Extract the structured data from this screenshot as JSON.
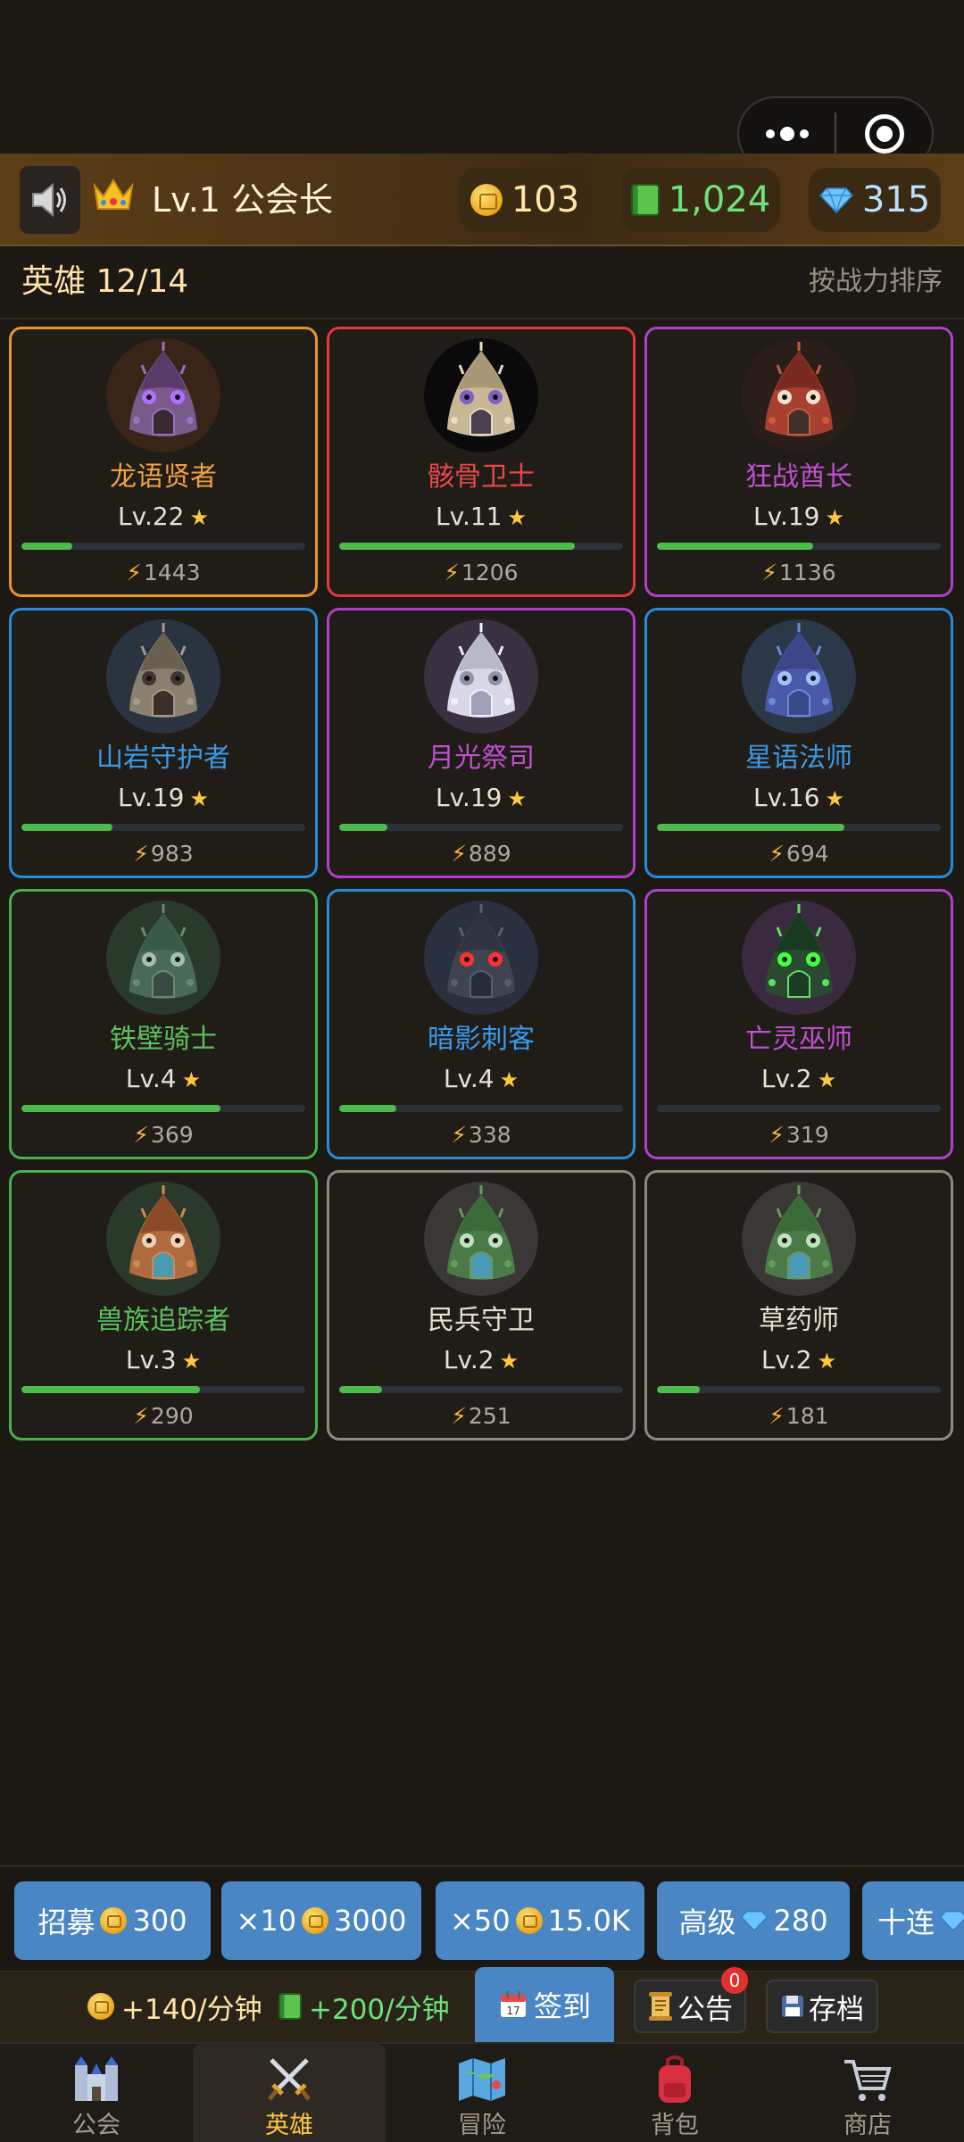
{
  "top_bar": {
    "rank_label": "Lv.1 公会长",
    "gold": "103",
    "books": "1,024",
    "gems": "315"
  },
  "heroes_header": {
    "title": "英雄 12/14",
    "sort_label": "按战力排序"
  },
  "colors": {
    "legendary": "#e8962a",
    "red": "#e03a3a",
    "epic": "#b040c8",
    "rare": "#2a8ad8",
    "uncommon": "#4cae4c",
    "common": "#8c8884",
    "xp_fill": "#4cbb4c"
  },
  "heroes": [
    {
      "name": "龙语贤者",
      "level": "Lv.22",
      "power": "1443",
      "xp": 0.18,
      "color": "#e8962a",
      "namecolor": "#f0a040",
      "avatar": "purple"
    },
    {
      "name": "骸骨卫士",
      "level": "Lv.11",
      "power": "1206",
      "xp": 0.83,
      "color": "#e03a3a",
      "namecolor": "#e84848",
      "avatar": "bone"
    },
    {
      "name": "狂战酋长",
      "level": "Lv.19",
      "power": "1136",
      "xp": 0.55,
      "color": "#b040c8",
      "namecolor": "#c050d0",
      "avatar": "red"
    },
    {
      "name": "山岩守护者",
      "level": "Lv.19",
      "power": "983",
      "xp": 0.32,
      "color": "#2a8ad8",
      "namecolor": "#3a9ae8",
      "avatar": "stone"
    },
    {
      "name": "月光祭司",
      "level": "Lv.19",
      "power": "889",
      "xp": 0.17,
      "color": "#b040c8",
      "namecolor": "#c050d0",
      "avatar": "white"
    },
    {
      "name": "星语法师",
      "level": "Lv.16",
      "power": "694",
      "xp": 0.66,
      "color": "#2a8ad8",
      "namecolor": "#3a9ae8",
      "avatar": "blue"
    },
    {
      "name": "铁壁骑士",
      "level": "Lv.4",
      "power": "369",
      "xp": 0.7,
      "color": "#4cae4c",
      "namecolor": "#5cc05c",
      "avatar": "mossy"
    },
    {
      "name": "暗影刺客",
      "level": "Lv.4",
      "power": "338",
      "xp": 0.2,
      "color": "#2a8ad8",
      "namecolor": "#3a9ae8",
      "avatar": "dark"
    },
    {
      "name": "亡灵巫师",
      "level": "Lv.2",
      "power": "319",
      "xp": 0.0,
      "color": "#b040c8",
      "namecolor": "#c050d0",
      "avatar": "ghoul"
    },
    {
      "name": "兽族追踪者",
      "level": "Lv.3",
      "power": "290",
      "xp": 0.63,
      "color": "#4cae4c",
      "namecolor": "#5cc05c",
      "avatar": "orange"
    },
    {
      "name": "民兵守卫",
      "level": "Lv.2",
      "power": "251",
      "xp": 0.15,
      "color": "#8c8884",
      "namecolor": "#e8e0d0",
      "avatar": "green"
    },
    {
      "name": "草药师",
      "level": "Lv.2",
      "power": "181",
      "xp": 0.15,
      "color": "#8c8884",
      "namecolor": "#e8e0d0",
      "avatar": "green"
    }
  ],
  "recruit": [
    {
      "label": "招募",
      "cost": "300",
      "currency": "coin"
    },
    {
      "label": "×10",
      "cost": "3000",
      "currency": "coin"
    },
    {
      "label": "×50",
      "cost": "15.0K",
      "currency": "coin"
    },
    {
      "label": "高级",
      "cost": "280",
      "currency": "gem"
    },
    {
      "label": "十连",
      "cost": "",
      "currency": "gem"
    }
  ],
  "income": {
    "gold_rate": "+140/分钟",
    "book_rate": "+200/分钟",
    "checkin_label": "签到",
    "notice_label": "公告",
    "notice_badge": "0",
    "save_label": "存档"
  },
  "nav": [
    {
      "label": "公会",
      "icon": "castle-icon"
    },
    {
      "label": "英雄",
      "icon": "crossed-swords-icon"
    },
    {
      "label": "冒险",
      "icon": "map-icon"
    },
    {
      "label": "背包",
      "icon": "backpack-icon"
    },
    {
      "label": "商店",
      "icon": "cart-icon"
    }
  ],
  "nav_active": 1
}
